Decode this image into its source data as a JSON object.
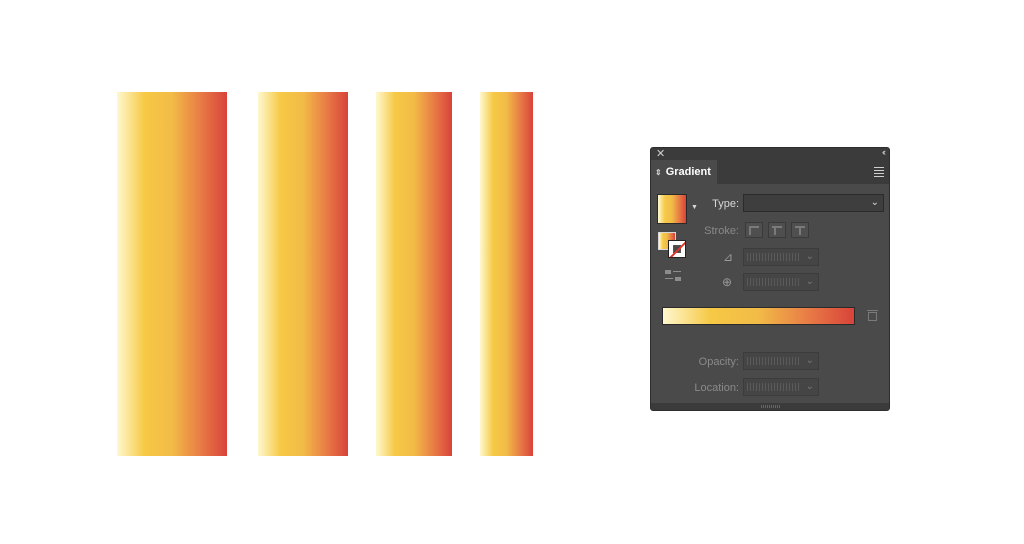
{
  "colors": {
    "gradient_stops": [
      "#fff8cf",
      "#f6c945",
      "#f2bb47",
      "#e97e46",
      "#d8433a"
    ],
    "panel_bg": "#4a4a4a",
    "panel_header": "#3b3b3b"
  },
  "icons": {
    "close": "close-icon",
    "collapse": "double-chevron-icon",
    "tab_arrows": "up-down-arrows-icon",
    "menu": "hamburger-menu-icon",
    "caret": "triangle-down-icon",
    "angle": "angle-icon",
    "aspect": "aspect-ratio-icon",
    "trash": "trash-icon",
    "reverse": "reverse-gradient-icon"
  },
  "panel": {
    "close_glyph": "✕",
    "collapse_glyph": "‹‹",
    "tab_arrows_glyph": "⇕",
    "tab_label": "Gradient",
    "type_label": "Type:",
    "type_value": "",
    "stroke_label": "Stroke:",
    "opacity_label": "Opacity:",
    "location_label": "Location:",
    "angle_glyph": "⊿",
    "aspect_glyph": "⊕",
    "chevron_glyph": "⌄",
    "caret_glyph": "▼"
  }
}
